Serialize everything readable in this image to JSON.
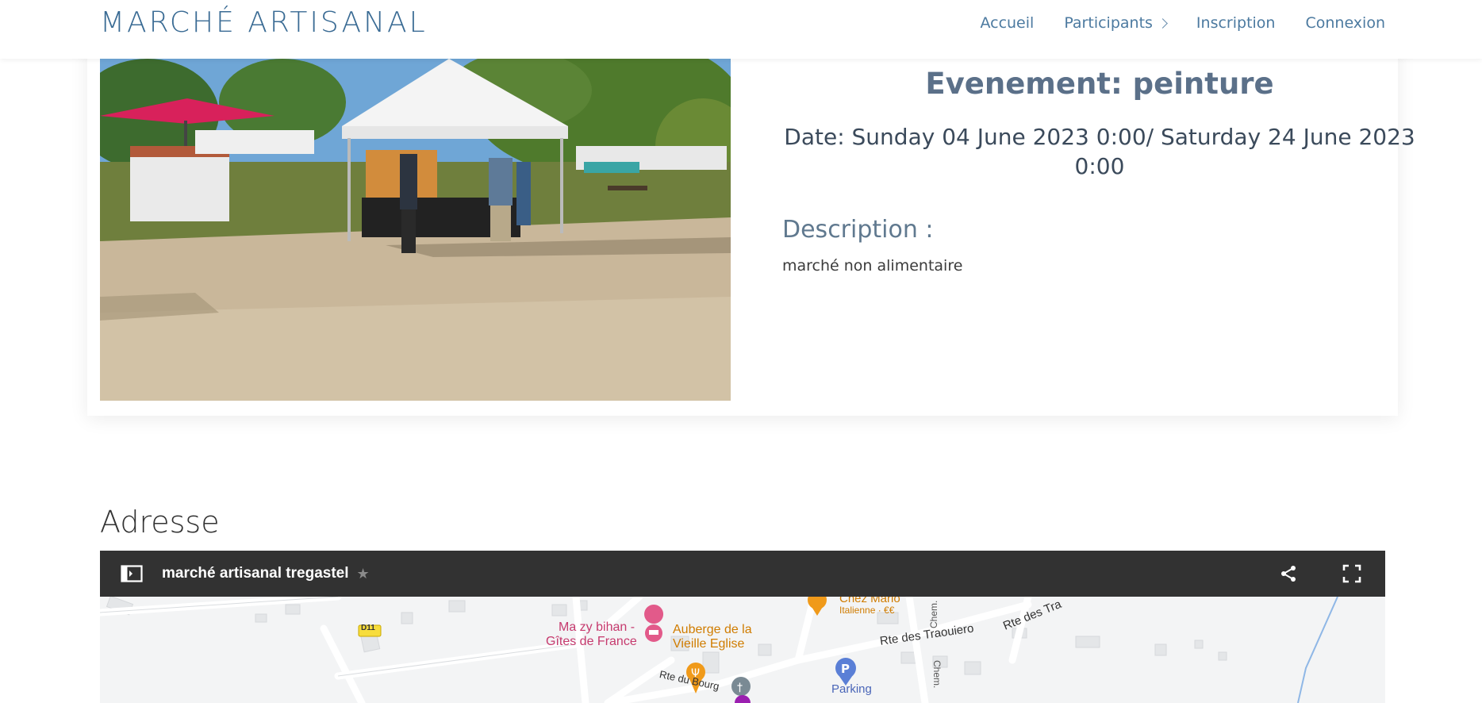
{
  "header": {
    "brand": "MARCHÉ ARTISANAL",
    "nav": [
      {
        "label": "Accueil"
      },
      {
        "label": "Participants",
        "icon": "chevron-right-icon"
      },
      {
        "label": "Inscription"
      },
      {
        "label": "Connexion"
      }
    ]
  },
  "event": {
    "title": "Evenement: peinture",
    "date": "Date: Sunday 04 June 2023 0:00/ Saturday 24 June 2023 0:00",
    "description_label": "Description :",
    "description": "marché non alimentaire",
    "photo_icon": "market-stalls-photo"
  },
  "address": {
    "heading": "Adresse",
    "map": {
      "title": "marché artisanal tregastel",
      "icons": [
        "sidebar-toggle-icon",
        "star-icon",
        "share-icon",
        "fullscreen-icon"
      ],
      "labels": {
        "road_d11": "D11",
        "gite_line1": "Ma zy bihan -",
        "gite_line2": "Gîtes de France",
        "auberge_line1": "Auberge de la",
        "auberge_line2": "Vieille Eglise",
        "chez_mario": "Chez Mario",
        "italienne": "Italienne · €€",
        "rte_traouiero": "Rte des Traouiero",
        "rte_des_tra": "Rte des Tra",
        "rte_du_bourg": "Rte du Bourg",
        "chem_a": "Chem.",
        "chem_b": "Chem.",
        "parking": "Parking"
      }
    }
  },
  "colors": {
    "brand": "#3a6b94",
    "nav": "#4c7aa0",
    "title": "#5b7089",
    "map_bar": "#323232"
  }
}
